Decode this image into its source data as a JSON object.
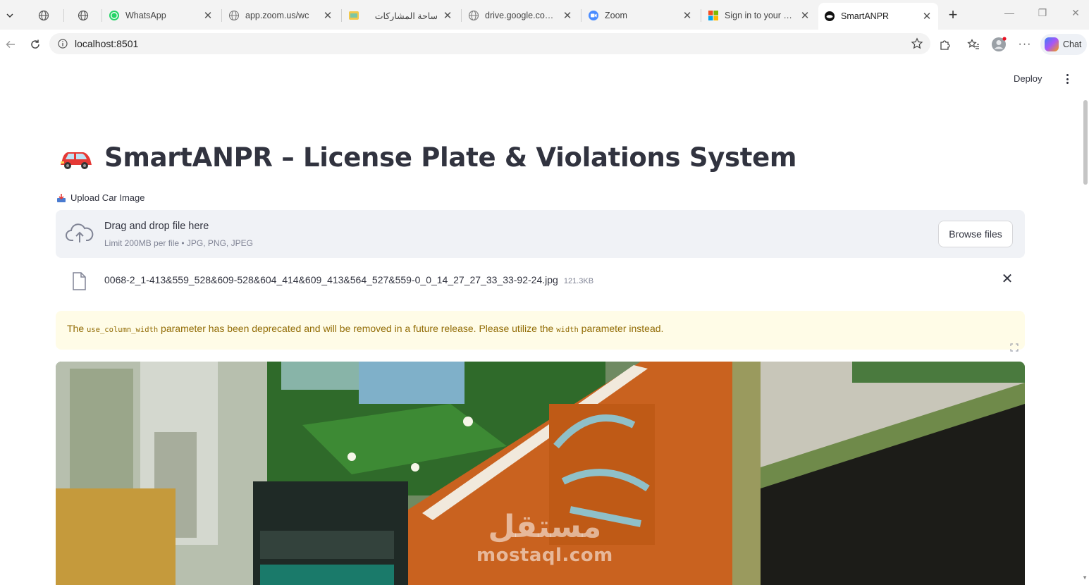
{
  "browser": {
    "tabs": [
      {
        "title": "WhatsApp",
        "icon": "whatsapp-icon"
      },
      {
        "title": "app.zoom.us/wc",
        "icon": "globe-icon"
      },
      {
        "title": "ساحة المشاركات",
        "icon": "image-icon"
      },
      {
        "title": "drive.google.com/fil",
        "icon": "globe-icon"
      },
      {
        "title": "Zoom",
        "icon": "zoom-icon"
      },
      {
        "title": "Sign in to your accou",
        "icon": "microsoft-icon"
      },
      {
        "title": "SmartANPR",
        "icon": "streamlit-icon"
      }
    ],
    "address": "localhost:8501",
    "copilot_label": "Chat"
  },
  "header": {
    "deploy_label": "Deploy"
  },
  "main": {
    "title": "SmartANPR – License Plate & Violations System",
    "upload_label": "Upload Car Image",
    "dropzone": {
      "title": "Drag and drop file here",
      "limit": "Limit 200MB per file • JPG, PNG, JPEG",
      "browse_label": "Browse files"
    },
    "file": {
      "name": "0068-2_1-413&559_528&609-528&604_414&609_413&564_527&559-0_0_14_27_27_33_33-92-24.jpg",
      "size": "121.3KB"
    },
    "warning": {
      "pre": "The ",
      "code1": "use_column_width",
      "mid": " parameter has been deprecated and will be removed in a future release. Please utilize the ",
      "code2": "width",
      "post": " parameter instead."
    }
  },
  "watermark": {
    "arabic": "مستقل",
    "latin": "mostaql.com"
  },
  "colors": {
    "text": "#31333f",
    "muted": "#808495",
    "dropzone_bg": "#f0f2f6",
    "warning_bg": "#fffce7",
    "warning_text": "#926c05"
  }
}
